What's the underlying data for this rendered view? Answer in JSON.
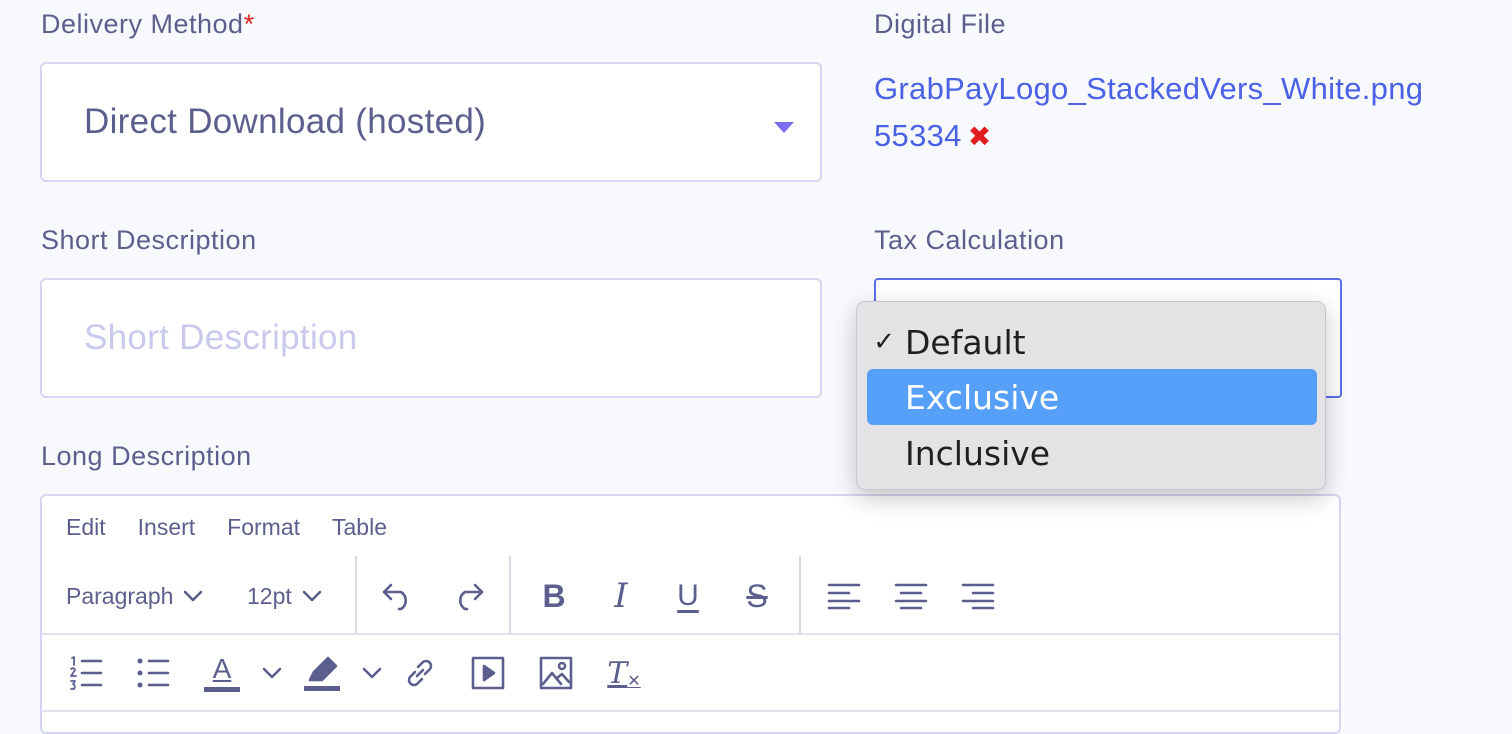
{
  "delivery": {
    "label": "Delivery Method",
    "required_mark": "*",
    "value": "Direct Download (hosted)"
  },
  "digital_file": {
    "label": "Digital File",
    "filename": "GrabPayLogo_StackedVers_White.png",
    "size": "55334",
    "remove_glyph": "✖"
  },
  "short_description": {
    "label": "Short Description",
    "placeholder": "Short Description"
  },
  "tax": {
    "label": "Tax Calculation",
    "options": [
      {
        "label": "Default",
        "checked": true,
        "highlighted": false
      },
      {
        "label": "Exclusive",
        "checked": false,
        "highlighted": true
      },
      {
        "label": "Inclusive",
        "checked": false,
        "highlighted": false
      }
    ],
    "check_glyph": "✓"
  },
  "long_description": {
    "label": "Long Description",
    "menu": [
      "Edit",
      "Insert",
      "Format",
      "Table"
    ],
    "block_format": "Paragraph",
    "font_size": "12pt",
    "bold_glyph": "B",
    "italic_glyph": "I",
    "underline_glyph": "U",
    "strike_glyph": "S",
    "text_color_glyph": "A",
    "clear_format_glyph": "T"
  },
  "colors": {
    "accent": "#7a6df0",
    "link": "#4b62e6",
    "error": "#e11d1d",
    "highlight": "#57a0f9"
  }
}
